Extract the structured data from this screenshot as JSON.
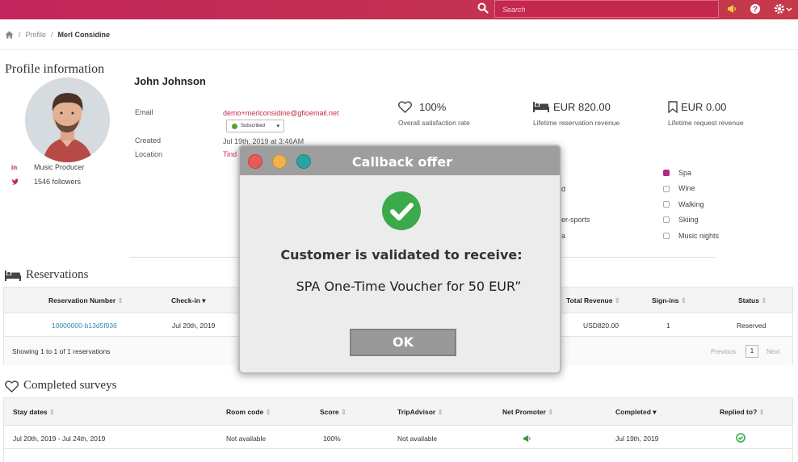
{
  "topbar": {
    "search_placeholder": "Search",
    "icons": [
      "search-icon",
      "megaphone-icon",
      "help-icon",
      "gear-icon"
    ]
  },
  "breadcrumb": {
    "items": [
      "Profile",
      "Merl Considine"
    ]
  },
  "profile": {
    "section_title": "Profile information",
    "name": "John Johnson",
    "email_label": "Email",
    "email": "demo+merlconsidine@gfioemail.net",
    "subscription_status": "Subscribed",
    "created_label": "Created",
    "created": "Jul 19th, 2019 at 3:46AM",
    "location_label": "Location",
    "location_partial": "Tind",
    "social": {
      "linkedin_title": "Music Producer",
      "twitter_followers": "1546 followers"
    },
    "stats": [
      {
        "value": "100%",
        "label": "Overall satisfaction rate",
        "icon": "heart-icon"
      },
      {
        "value": "EUR 820.00",
        "label": "Lifetime reservation revenue",
        "icon": "bed-icon"
      },
      {
        "value": "EUR 0.00",
        "label": "Lifetime request revenue",
        "icon": "bookmark-icon"
      }
    ],
    "partial_col": [
      "d",
      "er-sports",
      "a"
    ],
    "interests": [
      {
        "label": "Spa",
        "checked": true
      },
      {
        "label": "Wine",
        "checked": false
      },
      {
        "label": "Walking",
        "checked": false
      },
      {
        "label": "Skiing",
        "checked": false
      },
      {
        "label": "Music nights",
        "checked": false
      }
    ]
  },
  "reservations": {
    "title": "Reservations",
    "columns": [
      "Reservation Number",
      "Check-in",
      "Total Revenue",
      "Sign-ins",
      "Status"
    ],
    "rows": [
      {
        "number": "10000000-b13d5f036",
        "checkin": "Jul 20th, 2019",
        "revenue": "USD820.00",
        "signins": "1",
        "status": "Reserved"
      }
    ],
    "showing": "Showing 1 to 1 of 1 reservations",
    "pager": {
      "previous": "Previous",
      "current": "1",
      "next": "Next"
    }
  },
  "surveys": {
    "title": "Completed surveys",
    "columns": [
      "Stay dates",
      "Room code",
      "Score",
      "TripAdvisor",
      "Net Promoter",
      "Completed",
      "Replied to?"
    ],
    "rows": [
      {
        "stay": "Jul 20th, 2019 - Jul 24th, 2019",
        "room": "Not available",
        "score": "100%",
        "tripadvisor": "Not available",
        "completed": "Jul 19th, 2019"
      }
    ]
  },
  "modal": {
    "title": "Callback offer",
    "line1": "Customer is validated to receive:",
    "line2": "SPA One-Time Voucher for 50 EUR”",
    "ok_label": "OK",
    "traffic_colors": [
      "#e8595a",
      "#efb24e",
      "#2aa3a3"
    ]
  }
}
